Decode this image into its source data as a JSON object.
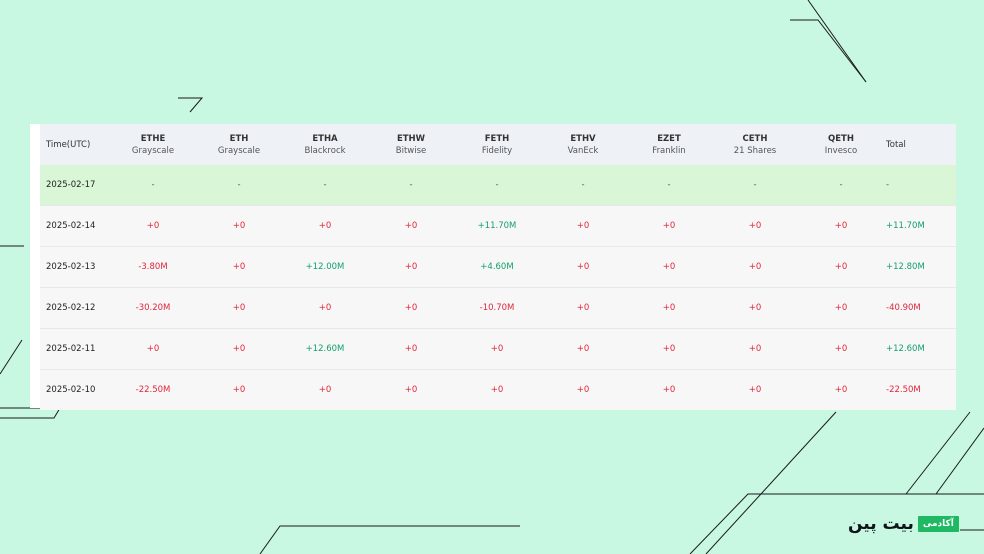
{
  "table": {
    "headers": [
      {
        "ticker": "Time(UTC)",
        "issuer": ""
      },
      {
        "ticker": "ETHE",
        "issuer": "Grayscale"
      },
      {
        "ticker": "ETH",
        "issuer": "Grayscale"
      },
      {
        "ticker": "ETHA",
        "issuer": "Blackrock"
      },
      {
        "ticker": "ETHW",
        "issuer": "Bitwise"
      },
      {
        "ticker": "FETH",
        "issuer": "Fidelity"
      },
      {
        "ticker": "ETHV",
        "issuer": "VanEck"
      },
      {
        "ticker": "EZET",
        "issuer": "Franklin"
      },
      {
        "ticker": "CETH",
        "issuer": "21 Shares"
      },
      {
        "ticker": "QETH",
        "issuer": "Invesco"
      },
      {
        "ticker": "Total",
        "issuer": ""
      }
    ],
    "rows": [
      {
        "date": "2025-02-17",
        "values": [
          "-",
          "-",
          "-",
          "-",
          "-",
          "-",
          "-",
          "-",
          "-"
        ],
        "total": "-"
      },
      {
        "date": "2025-02-14",
        "values": [
          "+0",
          "+0",
          "+0",
          "+0",
          "+11.70M",
          "+0",
          "+0",
          "+0",
          "+0"
        ],
        "total": "+11.70M"
      },
      {
        "date": "2025-02-13",
        "values": [
          "-3.80M",
          "+0",
          "+12.00M",
          "+0",
          "+4.60M",
          "+0",
          "+0",
          "+0",
          "+0"
        ],
        "total": "+12.80M"
      },
      {
        "date": "2025-02-12",
        "values": [
          "-30.20M",
          "+0",
          "+0",
          "+0",
          "-10.70M",
          "+0",
          "+0",
          "+0",
          "+0"
        ],
        "total": "-40.90M"
      },
      {
        "date": "2025-02-11",
        "values": [
          "+0",
          "+0",
          "+12.60M",
          "+0",
          "+0",
          "+0",
          "+0",
          "+0",
          "+0"
        ],
        "total": "+12.60M"
      },
      {
        "date": "2025-02-10",
        "values": [
          "-22.50M",
          "+0",
          "+0",
          "+0",
          "+0",
          "+0",
          "+0",
          "+0",
          "+0"
        ],
        "total": "-22.50M"
      }
    ]
  },
  "colors": {
    "negative": "#e0263c",
    "positive": "#13a06a",
    "background": "#c8f7e2",
    "highlight_row": "#d9f7d6",
    "brand": "#1fb863"
  },
  "logo": {
    "word": "بیت پین",
    "badge": "آکادمی"
  }
}
